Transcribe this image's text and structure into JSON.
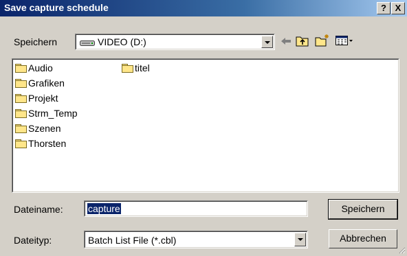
{
  "dialog": {
    "title": "Save capture schedule",
    "help_glyph": "?",
    "close_glyph": "X"
  },
  "location": {
    "label": "Speichern",
    "drive_label": "VIDEO (D:)"
  },
  "toolbar": {
    "icons": [
      "drive-icon",
      "back-arrow-icon",
      "up-folder-icon",
      "new-folder-icon",
      "view-menu-icon"
    ]
  },
  "files": [
    {
      "name": "Audio",
      "type": "folder"
    },
    {
      "name": "Grafiken",
      "type": "folder"
    },
    {
      "name": "Projekt",
      "type": "folder"
    },
    {
      "name": "Strm_Temp",
      "type": "folder"
    },
    {
      "name": "Szenen",
      "type": "folder"
    },
    {
      "name": "Thorsten",
      "type": "folder"
    },
    {
      "name": "titel",
      "type": "folder"
    }
  ],
  "filename": {
    "label": "Dateiname:",
    "value": "capture"
  },
  "filetype": {
    "label": "Dateityp:",
    "value": "Batch List File (*.cbl)"
  },
  "buttons": {
    "save": "Speichern",
    "cancel": "Abbrechen"
  },
  "colors": {
    "title_bar_start": "#0a246a",
    "title_bar_end": "#a6caf0",
    "dialog_bg": "#d4d0c8",
    "selection": "#0a246a"
  }
}
